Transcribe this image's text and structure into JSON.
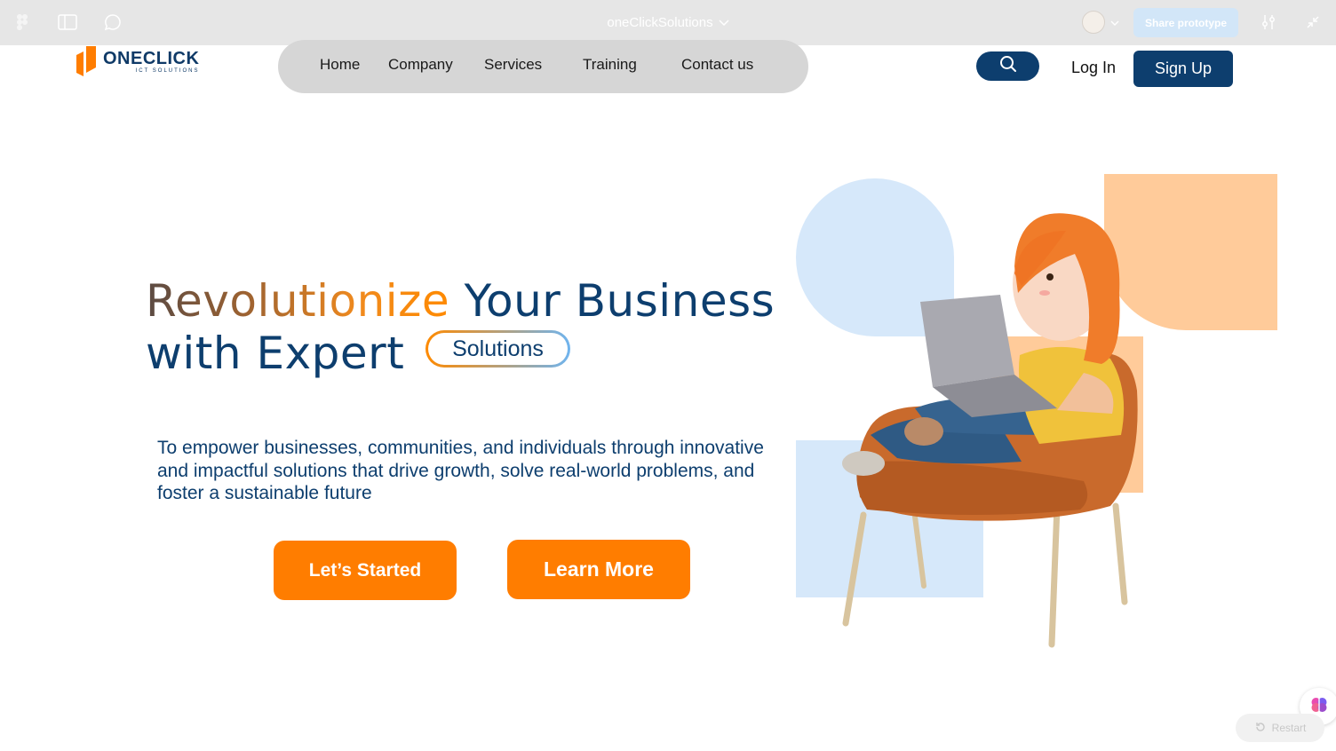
{
  "toolbar": {
    "file_name": "oneClickSolutions",
    "share_label": "Share prototype",
    "icons": [
      "figma-logo-icon",
      "sidebar-toggle-icon",
      "comment-icon",
      "chevron-down-icon",
      "avatar",
      "settings-sliders-icon",
      "collapse-icon"
    ]
  },
  "brand": {
    "name": "ONECLICK",
    "tagline": "ICT SOLUTIONS",
    "colors": {
      "navy": "#0d3e6e",
      "orange": "#ff7d00",
      "light_blue": "#d6e8fa",
      "peach": "#ffcb9a"
    }
  },
  "nav": {
    "items": [
      {
        "label": "Home"
      },
      {
        "label": "Company"
      },
      {
        "label": "Services"
      },
      {
        "label": "Training"
      },
      {
        "label": "Contact us"
      }
    ],
    "login_label": "Log In",
    "signup_label": "Sign Up"
  },
  "hero": {
    "headline_gradient_word": "Revolutionize",
    "headline_rest": "Your Business",
    "headline_line2": "with Expert",
    "highlight_chip": "Solutions",
    "mission": "To empower businesses, communities, and individuals through innovative and impactful solutions that drive growth, solve real-world problems, and foster a sustainable future",
    "primary_cta": "Let’s Started",
    "secondary_cta": "Learn More"
  },
  "widgets": {
    "restart_label": "Restart"
  }
}
